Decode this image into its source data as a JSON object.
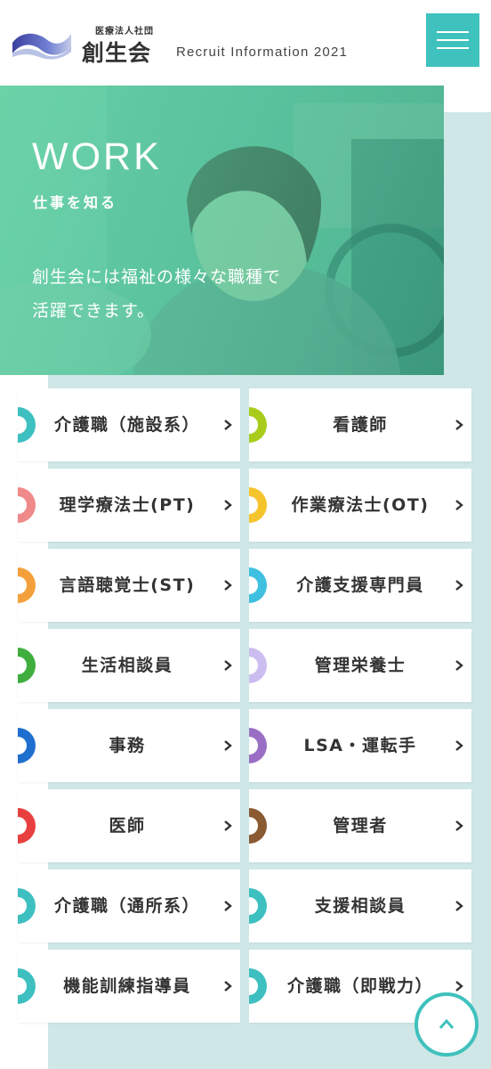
{
  "header": {
    "org_small": "医療法人社団",
    "org_name": "創生会",
    "recruit": "Recruit Information 2021",
    "menu_icon": "hamburger-icon"
  },
  "hero": {
    "title": "WORK",
    "subtitle": "仕事を知る",
    "text_line1": "創生会には福祉の様々な職種で",
    "text_line2": "活躍できます。"
  },
  "jobs": [
    {
      "label": "介護職（施設系）",
      "color": "#3ebfc0"
    },
    {
      "label": "看護師",
      "color": "#a9cc1c"
    },
    {
      "label": "理学療法士(PT)",
      "color": "#f08a8a"
    },
    {
      "label": "作業療法士(OT)",
      "color": "#f5c32c"
    },
    {
      "label": "言語聴覚士(ST)",
      "color": "#f3a03c"
    },
    {
      "label": "介護支援専門員",
      "color": "#3fc0e0"
    },
    {
      "label": "生活相談員",
      "color": "#3fae3f"
    },
    {
      "label": "管理栄養士",
      "color": "#cbbdf0"
    },
    {
      "label": "事務",
      "color": "#1f6fcf"
    },
    {
      "label": "LSA・運転手",
      "color": "#9b6ec6"
    },
    {
      "label": "医師",
      "color": "#e84040"
    },
    {
      "label": "管理者",
      "color": "#8a5a32"
    },
    {
      "label": "介護職（通所系）",
      "color": "#3ebfc0"
    },
    {
      "label": "支援相談員",
      "color": "#3ebfc0"
    },
    {
      "label": "機能訓練指導員",
      "color": "#3ebfc0"
    },
    {
      "label": "介護職（即戦力）",
      "color": "#3ebfc0"
    }
  ],
  "to_top_icon": "chevron-up-icon",
  "accent": "#3fc1bd"
}
